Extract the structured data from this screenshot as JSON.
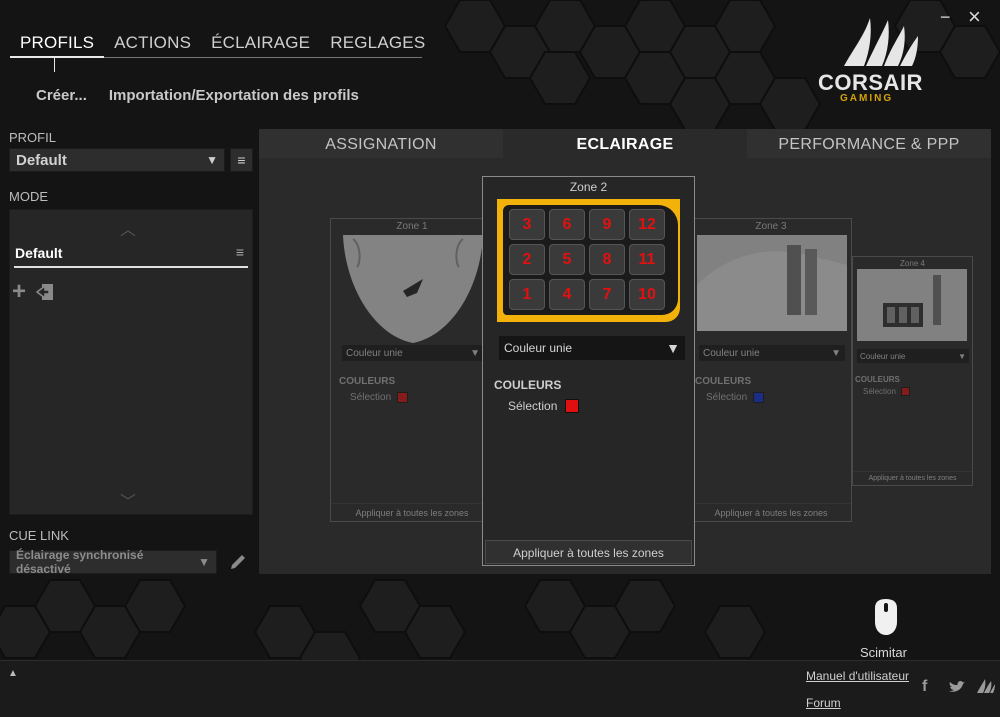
{
  "window": {
    "minimize": "−",
    "close": "×"
  },
  "topnav": {
    "tabs": [
      "PROFILS",
      "ACTIONS",
      "ÉCLAIRAGE",
      "REGLAGES"
    ]
  },
  "subnav": {
    "create": "Créer...",
    "import_export": "Importation/Exportation des profils"
  },
  "logo": {
    "name": "CORSAIR",
    "sub": "GAMING"
  },
  "profile": {
    "label": "PROFIL",
    "value": "Default"
  },
  "mode": {
    "label": "MODE",
    "value": "Default"
  },
  "cuelink": {
    "label": "CUE LINK",
    "value": "Éclairage synchronisé désactivé"
  },
  "main_tabs": [
    "ASSIGNATION",
    "ECLAIRAGE",
    "PERFORMANCE & PPP"
  ],
  "zones": {
    "z1": {
      "title": "Zone 1",
      "mode": "Couleur unie",
      "colors_label": "COULEURS",
      "selection_label": "Sélection",
      "color": "#e01010",
      "apply": "Appliquer à toutes les zones"
    },
    "z2": {
      "title": "Zone 2",
      "mode": "Couleur unie",
      "colors_label": "COULEURS",
      "selection_label": "Sélection",
      "color": "#e01010",
      "apply": "Appliquer à toutes les zones",
      "keys": [
        "3",
        "6",
        "9",
        "12",
        "2",
        "5",
        "8",
        "11",
        "1",
        "4",
        "7",
        "10"
      ]
    },
    "z3": {
      "title": "Zone 3",
      "mode": "Couleur unie",
      "colors_label": "COULEURS",
      "selection_label": "Sélection",
      "color": "#1030e0",
      "apply": "Appliquer à toutes les zones"
    },
    "z4": {
      "title": "Zone 4",
      "mode": "Couleur unie",
      "colors_label": "COULEURS",
      "selection_label": "Sélection",
      "color": "#e01010",
      "apply": "Appliquer à toutes les zones"
    }
  },
  "device": {
    "name": "Scimitar"
  },
  "footer": {
    "manual": "Manuel d'utilisateur",
    "forum": "Forum",
    "expand": "▲"
  }
}
